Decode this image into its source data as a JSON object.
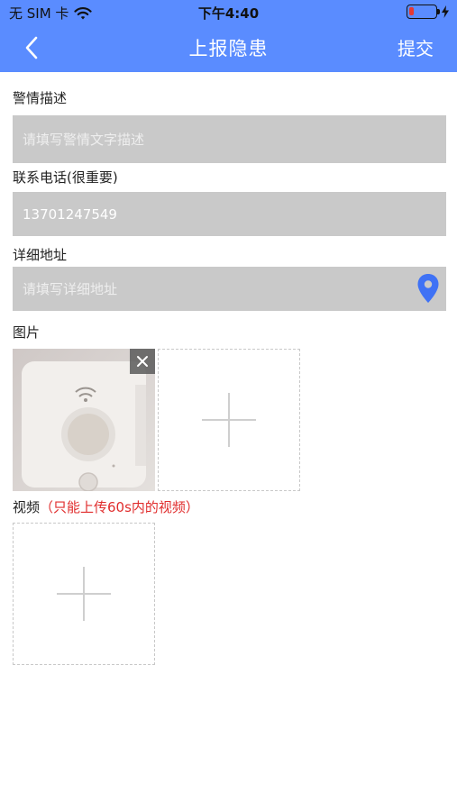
{
  "status": {
    "carrier": "无 SIM 卡",
    "time": "下午4:40",
    "battery_color": "#e53935"
  },
  "nav": {
    "title": "上报隐患",
    "submit_label": "提交",
    "bg_color": "#5a8cff"
  },
  "form": {
    "description": {
      "label": "警情描述",
      "placeholder": "请填写警情文字描述",
      "value": ""
    },
    "phone": {
      "label": "联系电话(很重要)",
      "value": "13701247549"
    },
    "address": {
      "label": "详细地址",
      "placeholder": "请填写详细地址",
      "value": "",
      "icon": "location-pin-icon"
    }
  },
  "images": {
    "label": "图片",
    "uploaded_count": 1
  },
  "video": {
    "label": "视频",
    "note": "（只能上传60s内的视频）",
    "note_color": "#e02d2d"
  }
}
